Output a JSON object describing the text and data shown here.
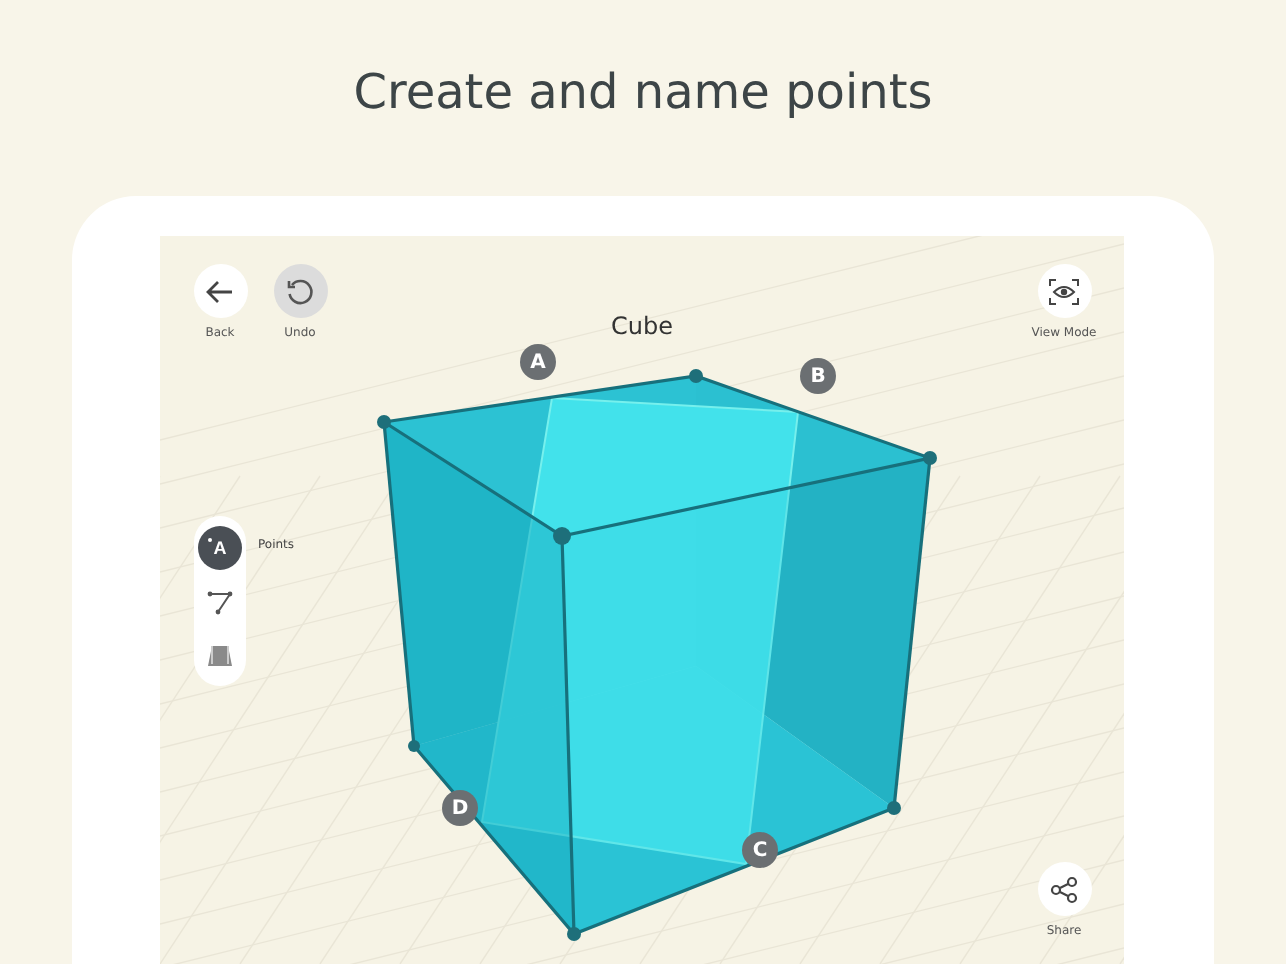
{
  "headline": "Create and name points",
  "screen": {
    "title": "Cube",
    "buttons": [
      {
        "kind": "back",
        "label": "Back"
      },
      {
        "kind": "undo",
        "label": "Undo"
      },
      {
        "kind": "view",
        "label": "View Mode"
      },
      {
        "kind": "share",
        "label": "Share"
      }
    ],
    "tools": [
      {
        "kind": "point",
        "glyph": "A",
        "label": "Points",
        "selected": true
      },
      {
        "kind": "segment",
        "selected": false
      },
      {
        "kind": "prism",
        "selected": false
      }
    ],
    "points": [
      "A",
      "B",
      "C",
      "D"
    ]
  }
}
